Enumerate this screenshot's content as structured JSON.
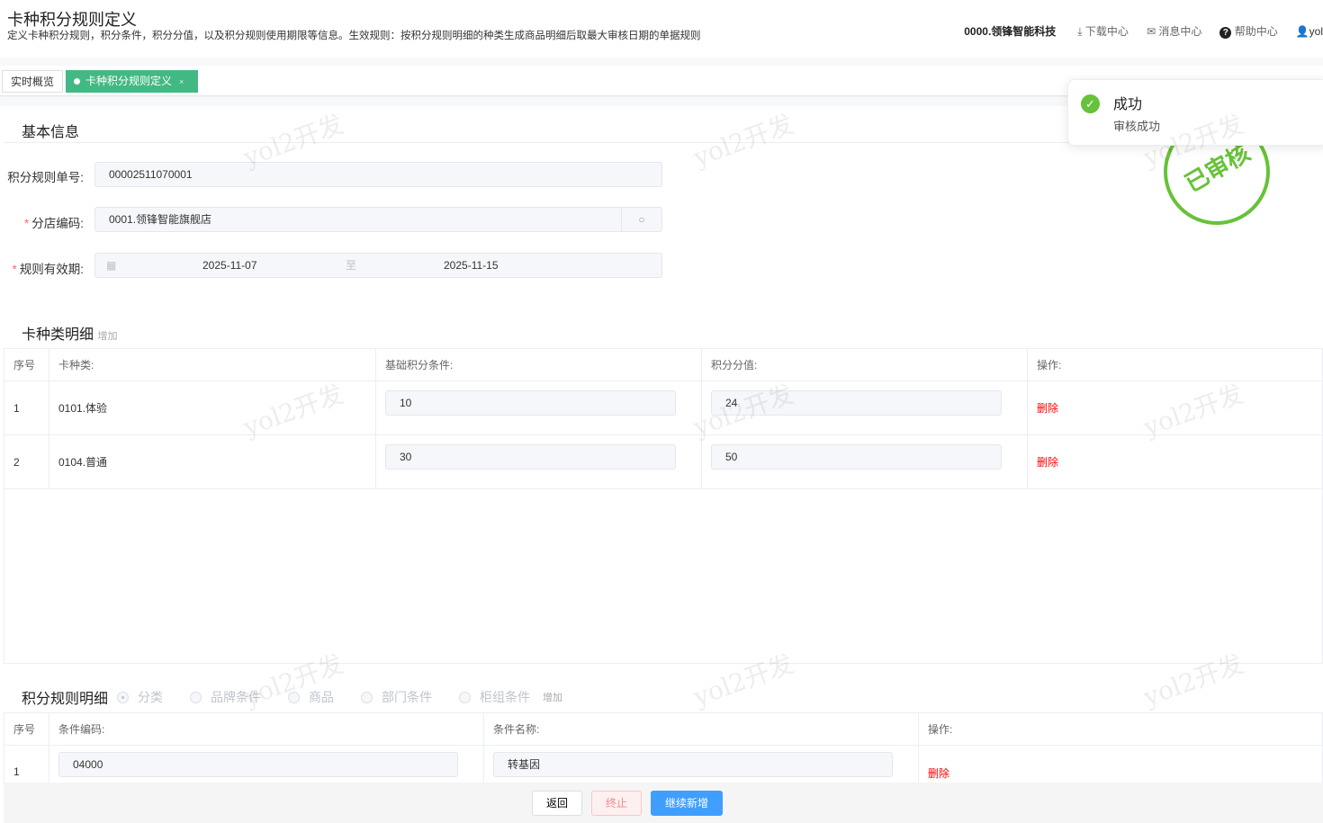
{
  "page": {
    "title": "卡种积分规则定义",
    "description": "定义卡种积分规则，积分条件，积分分值，以及积分规则使用期限等信息。生效规则：按积分规则明细的种类生成商品明细后取最大审核日期的单据规则"
  },
  "topnav": {
    "company": "0000.领锋智能科技",
    "download": "下载中心",
    "messages": "消息中心",
    "help": "帮助中心",
    "user": "yol"
  },
  "tabs": [
    {
      "label": "实时概览"
    },
    {
      "label": "卡种积分规则定义",
      "close": "×"
    }
  ],
  "basic": {
    "section": "基本信息",
    "rule_no_label": "积分规则单号:",
    "rule_no": "00002511070001",
    "store_label": "分店编码:",
    "store": "0001.领锋智能旗舰店",
    "period_label": "规则有效期:",
    "date_from": "2025-11-07",
    "date_sep": "至",
    "date_to": "2025-11-15"
  },
  "card_detail": {
    "section": "卡种类明细",
    "add": "增加",
    "headers": [
      "序号",
      "卡种类:",
      "基础积分条件:",
      "积分分值:",
      "操作:"
    ],
    "rows": [
      {
        "no": "1",
        "card": "0101.体验",
        "base": "10",
        "points": "24",
        "action": "删除"
      },
      {
        "no": "2",
        "card": "0104.普通",
        "base": "30",
        "points": "50",
        "action": "删除"
      }
    ]
  },
  "rule_detail": {
    "section": "积分规则明细",
    "radios": [
      "分类",
      "品牌条件",
      "商品",
      "部门条件",
      "柜组条件"
    ],
    "selected": "分类",
    "add": "增加",
    "headers": [
      "序号",
      "条件编码:",
      "条件名称:",
      "操作:"
    ],
    "rows": [
      {
        "no": "1",
        "code": "04000",
        "name": "转基因",
        "action": "删除"
      }
    ]
  },
  "footer": {
    "back": "返回",
    "stop": "终止",
    "continue": "继续新增"
  },
  "toast": {
    "title": "成功",
    "message": "审核成功"
  },
  "stamp": "已审核",
  "watermark": "yol2开发"
}
